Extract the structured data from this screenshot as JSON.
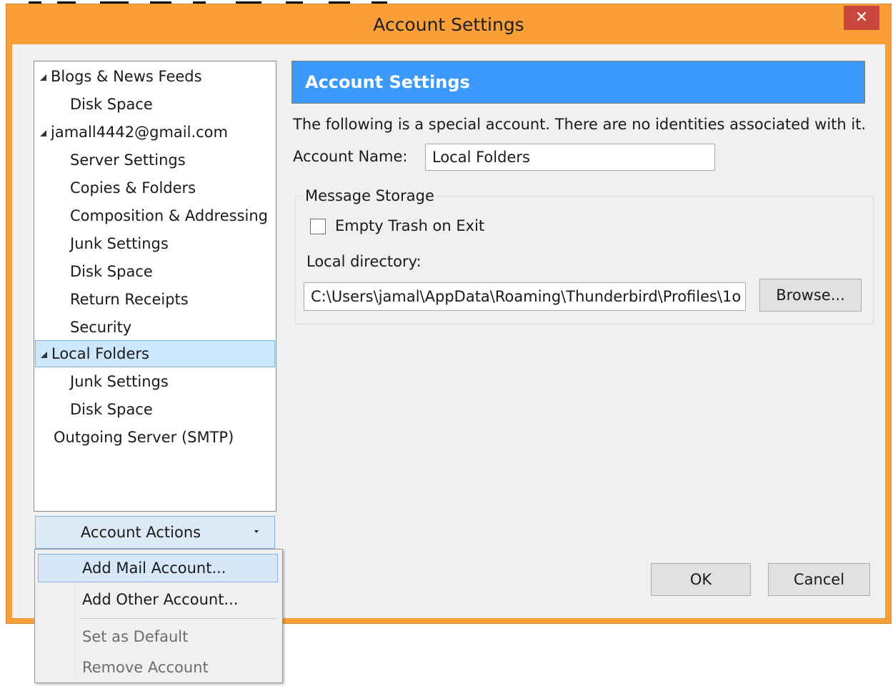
{
  "window": {
    "title": "Account Settings",
    "close_glyph": "✕"
  },
  "tree": [
    {
      "label": "Blogs & News Feeds",
      "expanded": true
    },
    {
      "label": "Disk Space"
    },
    {
      "label": "jamall4442@gmail.com",
      "expanded": true
    },
    {
      "label": "Server Settings"
    },
    {
      "label": "Copies & Folders"
    },
    {
      "label": "Composition & Addressing"
    },
    {
      "label": "Junk Settings"
    },
    {
      "label": "Disk Space"
    },
    {
      "label": "Return Receipts"
    },
    {
      "label": "Security"
    },
    {
      "label": "Local Folders",
      "expanded": true,
      "selected": true
    },
    {
      "label": "Junk Settings"
    },
    {
      "label": "Disk Space"
    },
    {
      "label": "Outgoing Server (SMTP)"
    }
  ],
  "account_actions": {
    "label": "Account Actions"
  },
  "menu": {
    "items": [
      {
        "label": "Add Mail Account...",
        "enabled": true,
        "highlighted": true
      },
      {
        "label": "Add Other Account...",
        "enabled": true
      },
      {
        "label": "Set as Default",
        "enabled": false
      },
      {
        "label": "Remove Account",
        "enabled": false
      }
    ]
  },
  "panel": {
    "header": "Account Settings",
    "description": "The following is a special account. There are no identities associated with it.",
    "account_name_label": "Account Name:",
    "account_name_value": "Local Folders",
    "storage_group_label": "Message Storage",
    "empty_trash_label": "Empty Trash on Exit",
    "empty_trash_checked": false,
    "local_directory_label": "Local directory:",
    "local_directory_value": "C:\\Users\\jamal\\AppData\\Roaming\\Thunderbird\\Profiles\\1o",
    "browse_label": "Browse..."
  },
  "buttons": {
    "ok": "OK",
    "cancel": "Cancel"
  },
  "colors": {
    "frame": "#fa9f37",
    "close": "#c9473c",
    "header": "#3b99fc",
    "selection": "#cce6fb"
  },
  "icons": {
    "close": "close-icon",
    "expand": "expand-triangle-icon",
    "dropdown": "dropdown-arrow-icon"
  }
}
